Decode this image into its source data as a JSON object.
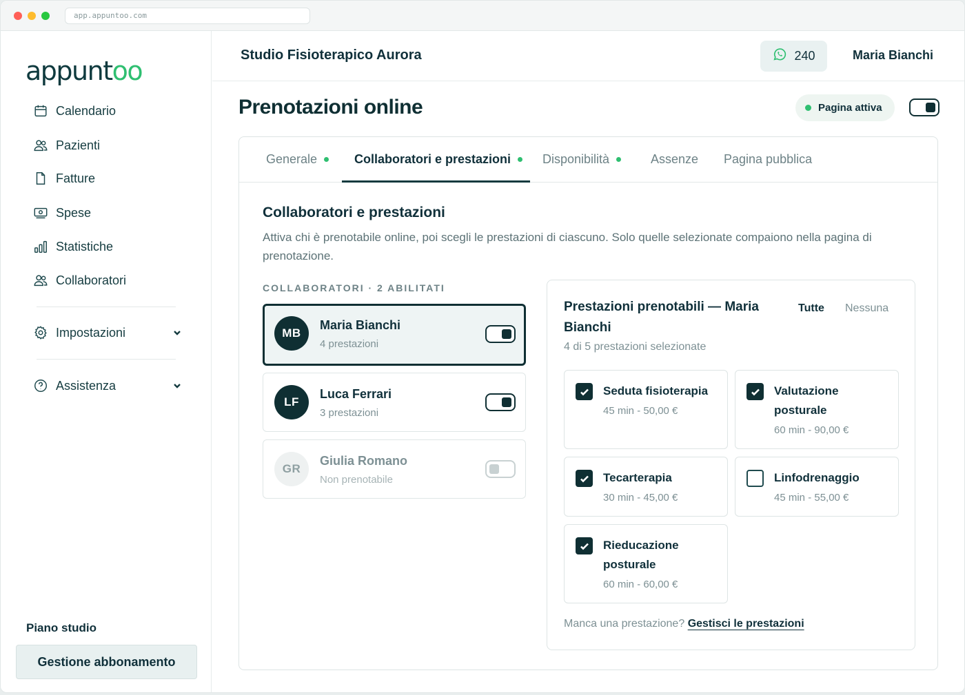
{
  "browser": {
    "url": "app.appuntoo.com"
  },
  "sidebar": {
    "logo": {
      "prefix": "appunt",
      "accent": "oo"
    },
    "items": [
      {
        "label": "Calendario",
        "icon": "calendar-icon"
      },
      {
        "label": "Pazienti",
        "icon": "users-icon"
      },
      {
        "label": "Fatture",
        "icon": "document-icon"
      },
      {
        "label": "Spese",
        "icon": "wallet-icon"
      },
      {
        "label": "Statistiche",
        "icon": "bar-chart-icon"
      },
      {
        "label": "Collaboratori",
        "icon": "users-icon"
      }
    ],
    "settings_label": "Impostazioni",
    "help_label": "Assistenza",
    "plan_label": "Piano studio",
    "subscription_button": "Gestione abbonamento"
  },
  "header": {
    "studio_name": "Studio Fisioterapico Aurora",
    "whatsapp_count": "240",
    "user_name": "Maria Bianchi"
  },
  "page": {
    "title": "Prenotazioni online",
    "status_label": "Pagina attiva",
    "page_active": true
  },
  "tabs": [
    {
      "label": "Generale",
      "dot": true,
      "active": false
    },
    {
      "label": "Collaboratori e prestazioni",
      "dot": true,
      "active": true
    },
    {
      "label": "Disponibilità",
      "dot": true,
      "active": false
    },
    {
      "label": "Assenze",
      "dot": false,
      "active": false
    },
    {
      "label": "Pagina pubblica",
      "dot": false,
      "active": false
    }
  ],
  "section": {
    "title": "Collaboratori e prestazioni",
    "description": "Attiva chi è prenotabile online, poi scegli le prestazioni di ciascuno. Solo quelle selezionate compaiono nella pagina di prenotazione.",
    "collaborators_header": "COLLABORATORI · 2 ABILITATI"
  },
  "collaborators": [
    {
      "initials": "MB",
      "name": "Maria Bianchi",
      "subtitle": "4 prestazioni",
      "enabled": true,
      "selected": true
    },
    {
      "initials": "LF",
      "name": "Luca Ferrari",
      "subtitle": "3 prestazioni",
      "enabled": true,
      "selected": false
    },
    {
      "initials": "GR",
      "name": "Giulia Romano",
      "subtitle": "Non prenotabile",
      "enabled": false,
      "selected": false
    }
  ],
  "services_panel": {
    "title": "Prestazioni prenotabili — Maria Bianchi",
    "subtitle": "4 di 5 prestazioni selezionate",
    "select_all": "Tutte",
    "select_none": "Nessuna",
    "footer_text": "Manca una prestazione?",
    "footer_link": "Gestisci le prestazioni",
    "services": [
      {
        "name": "Seduta fisioterapia",
        "meta": "45 min - 50,00 €",
        "checked": true
      },
      {
        "name": "Valutazione posturale",
        "meta": "60 min - 90,00 €",
        "checked": true
      },
      {
        "name": "Tecarterapia",
        "meta": "30 min - 45,00 €",
        "checked": true
      },
      {
        "name": "Linfodrenaggio",
        "meta": "45 min - 55,00 €",
        "checked": false
      },
      {
        "name": "Rieducazione posturale",
        "meta": "60 min - 60,00 €",
        "checked": true
      }
    ]
  },
  "colors": {
    "brand_dark": "#0f2f33",
    "accent_green": "#2fbf71"
  }
}
